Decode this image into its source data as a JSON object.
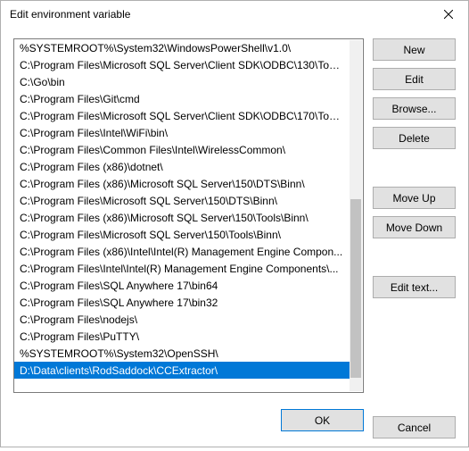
{
  "window": {
    "title": "Edit environment variable"
  },
  "list": {
    "items": [
      "%SYSTEMROOT%\\System32\\WindowsPowerShell\\v1.0\\",
      "C:\\Program Files\\Microsoft SQL Server\\Client SDK\\ODBC\\130\\Tool...",
      "C:\\Go\\bin",
      "C:\\Program Files\\Git\\cmd",
      "C:\\Program Files\\Microsoft SQL Server\\Client SDK\\ODBC\\170\\Tool...",
      "C:\\Program Files\\Intel\\WiFi\\bin\\",
      "C:\\Program Files\\Common Files\\Intel\\WirelessCommon\\",
      "C:\\Program Files (x86)\\dotnet\\",
      "C:\\Program Files (x86)\\Microsoft SQL Server\\150\\DTS\\Binn\\",
      "C:\\Program Files\\Microsoft SQL Server\\150\\DTS\\Binn\\",
      "C:\\Program Files (x86)\\Microsoft SQL Server\\150\\Tools\\Binn\\",
      "C:\\Program Files\\Microsoft SQL Server\\150\\Tools\\Binn\\",
      "C:\\Program Files (x86)\\Intel\\Intel(R) Management Engine Compon...",
      "C:\\Program Files\\Intel\\Intel(R) Management Engine Components\\...",
      "C:\\Program Files\\SQL Anywhere 17\\bin64",
      "C:\\Program Files\\SQL Anywhere 17\\bin32",
      "C:\\Program Files\\nodejs\\",
      "C:\\Program Files\\PuTTY\\",
      "%SYSTEMROOT%\\System32\\OpenSSH\\",
      "D:\\Data\\clients\\RodSaddock\\CCExtractor\\"
    ],
    "selectedIndex": 19
  },
  "buttons": {
    "new": "New",
    "edit": "Edit",
    "browse": "Browse...",
    "delete": "Delete",
    "moveUp": "Move Up",
    "moveDown": "Move Down",
    "editText": "Edit text...",
    "ok": "OK",
    "cancel": "Cancel"
  }
}
